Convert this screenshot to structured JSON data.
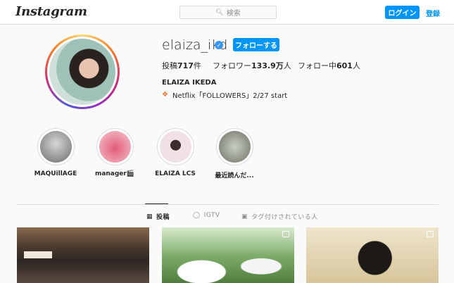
{
  "header": {
    "logo": "Instagram",
    "search_placeholder": "検索",
    "login_label": "ログイン",
    "signup_label": "登録"
  },
  "profile": {
    "username": "elaiza_ikd",
    "verified": true,
    "follow_label": "フォローする",
    "stats": {
      "posts_prefix": "投稿",
      "posts_value": "717",
      "posts_suffix": "件",
      "followers_prefix": "フォロワー",
      "followers_value": "133.9万",
      "followers_suffix": "人",
      "following_prefix": "フォロー中",
      "following_value": "601",
      "following_suffix": "人"
    },
    "full_name": "ELAIZA IKEDA",
    "bio_icon": "butterfly-emoji",
    "bio_text": "Netflix「FOLLOWERS」2/27 start"
  },
  "highlights": [
    {
      "label": "MAQUillAGE",
      "color": "#8a8a8a"
    },
    {
      "label": "manager🎬",
      "color": "#e98a9a"
    },
    {
      "label": "ELAIZA LCS",
      "color": "#c9a6ae"
    },
    {
      "label": "最近読んだ...",
      "color": "#9aa39a"
    }
  ],
  "tabs": [
    {
      "label": "投稿",
      "icon": "grid-icon",
      "active": true
    },
    {
      "label": "IGTV",
      "icon": "igtv-icon",
      "active": false
    },
    {
      "label": "タグ付けされている人",
      "icon": "tagged-icon",
      "active": false
    }
  ],
  "posts": [
    {
      "icon": "none",
      "colors": [
        "#5a4636",
        "#2d2622"
      ]
    },
    {
      "icon": "video-icon",
      "colors": [
        "#6f9a5c",
        "#cfe3c3"
      ]
    },
    {
      "icon": "carousel-icon",
      "colors": [
        "#d8c9a8",
        "#1e1a18"
      ]
    }
  ],
  "accent": "#0095f6"
}
